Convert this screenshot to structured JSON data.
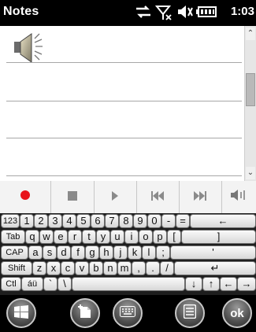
{
  "statusbar": {
    "app_title": "Notes",
    "clock": "1:03",
    "icons": [
      "data-sync-icon",
      "signal-off-icon",
      "volume-off-icon",
      "battery-icon"
    ]
  },
  "recording_toolbar": {
    "buttons": [
      "record-icon",
      "stop-icon",
      "play-icon",
      "skip-back-icon",
      "skip-forward-icon",
      "speaker-volume-icon"
    ],
    "record_color": "#e8141b"
  },
  "keyboard": {
    "rows": [
      [
        "123",
        "1",
        "2",
        "3",
        "4",
        "5",
        "6",
        "7",
        "8",
        "9",
        "0",
        "-",
        "=",
        "←"
      ],
      [
        "Tab",
        "q",
        "w",
        "e",
        "r",
        "t",
        "y",
        "u",
        "i",
        "o",
        "p",
        "[",
        "]"
      ],
      [
        "CAP",
        "a",
        "s",
        "d",
        "f",
        "g",
        "h",
        "j",
        "k",
        "l",
        ";",
        "'"
      ],
      [
        "Shift",
        "z",
        "x",
        "c",
        "v",
        "b",
        "n",
        "m",
        ",",
        ".",
        "/",
        "↵"
      ],
      [
        "Ctl",
        "áü",
        "`",
        "\\",
        "",
        "↓",
        "↑",
        "←",
        "→"
      ]
    ]
  },
  "softkeys": {
    "ok_label": "ok",
    "icons": [
      "windows-start-icon",
      "new-note-icon",
      "keyboard-icon",
      "menu-icon",
      "ok-button"
    ]
  }
}
